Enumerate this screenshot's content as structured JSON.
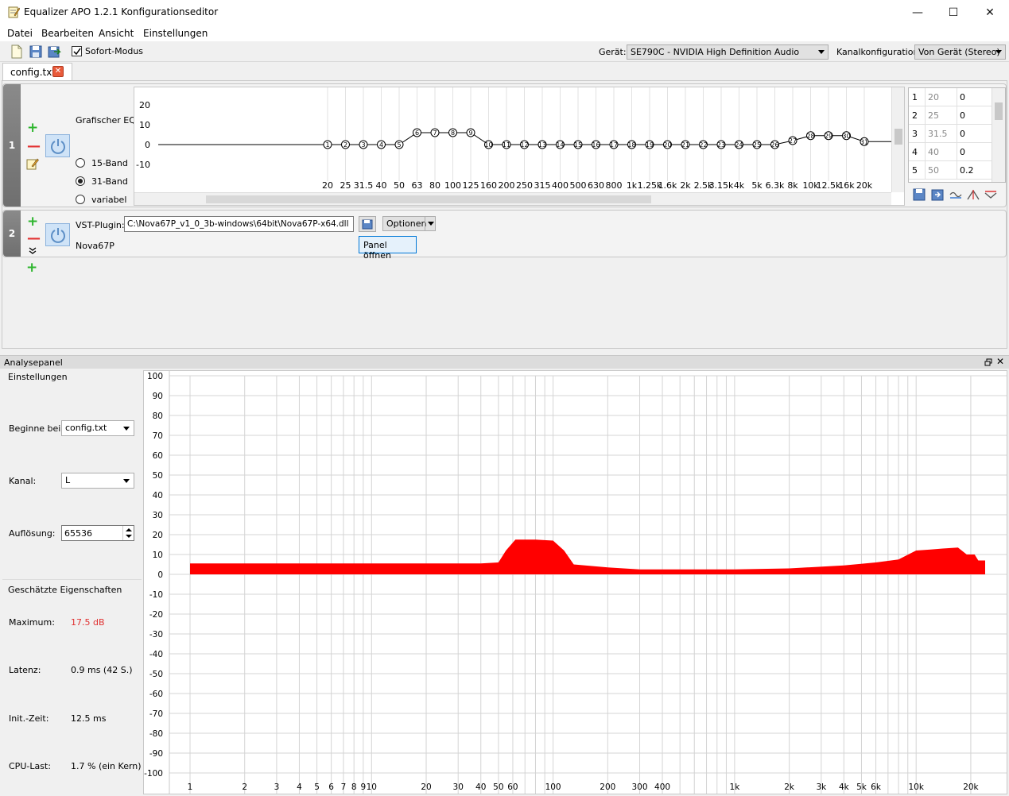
{
  "window": {
    "title": "Equalizer APO 1.2.1 Konfigurationseditor"
  },
  "menu": {
    "items": [
      "Datei",
      "Bearbeiten",
      "Ansicht",
      "Einstellungen"
    ]
  },
  "toolbar": {
    "instant_mode_label": "Sofort-Modus",
    "instant_mode_checked": true,
    "device_label": "Gerät:",
    "device_value": "SE790C - NVIDIA High Definition Audio",
    "channel_config_label": "Kanalkonfiguration:",
    "channel_config_value": "Von Gerät (Stereo)"
  },
  "tabs": [
    {
      "label": "config.txt"
    }
  ],
  "filters": [
    {
      "index": "1",
      "eq_label": "Grafischer EQ:",
      "modes": [
        "15-Band",
        "31-Band",
        "variabel"
      ],
      "selected_mode": "31-Band",
      "y_ticks": [
        "20",
        "10",
        "0",
        "-10"
      ],
      "freq_labels": [
        "20",
        "25",
        "31.5",
        "40",
        "50",
        "63",
        "80",
        "100",
        "125",
        "160",
        "200",
        "250",
        "315",
        "400",
        "500",
        "630",
        "800",
        "1k",
        "1.25k",
        "1.6k",
        "2k",
        "2.5k",
        "3.15k",
        "4k",
        "5k",
        "6.3k",
        "8k",
        "10k",
        "12.5k",
        "16k",
        "20k"
      ],
      "band_gains_db": [
        0,
        0,
        0,
        0,
        0,
        6,
        6,
        6,
        6,
        0,
        0,
        0,
        0,
        0,
        0,
        0,
        0,
        0,
        0,
        0,
        0,
        0,
        0,
        0,
        0,
        0,
        2,
        4.5,
        4.5,
        4.5,
        1.5
      ],
      "band_table": [
        {
          "n": "1",
          "freq": "20",
          "gain": "0"
        },
        {
          "n": "2",
          "freq": "25",
          "gain": "0"
        },
        {
          "n": "3",
          "freq": "31.5",
          "gain": "0"
        },
        {
          "n": "4",
          "freq": "40",
          "gain": "0"
        },
        {
          "n": "5",
          "freq": "50",
          "gain": "0.2"
        }
      ]
    },
    {
      "index": "2",
      "vst_label": "VST-Plugin:",
      "vst_path": "C:\\Nova67P_v1_0_3b-windows\\64bit\\Nova67P-x64.dll",
      "options_label": "Optionen",
      "open_panel_label": "Panel öffnen",
      "plugin_name": "Nova67P"
    }
  ],
  "analysis": {
    "title": "Analysepanel",
    "settings_title": "Einstellungen",
    "start_label": "Beginne bei:",
    "start_value": "config.txt",
    "channel_label": "Kanal:",
    "channel_value": "L",
    "resolution_label": "Auflösung:",
    "resolution_value": "65536",
    "estimated_title": "Geschätzte Eigenschaften",
    "max_label": "Maximum:",
    "max_value": "17.5 dB",
    "latency_label": "Latenz:",
    "latency_value": "0.9 ms (42 S.)",
    "init_label": "Init.-Zeit:",
    "init_value": "12.5 ms",
    "cpu_label": "CPU-Last:",
    "cpu_value": "1.7 % (ein Kern)"
  },
  "chart_data": {
    "type": "area",
    "x_scale": "log",
    "xlim": [
      1,
      24000
    ],
    "ylim": [
      -100,
      100
    ],
    "y_ticks": [
      100,
      90,
      80,
      70,
      60,
      50,
      40,
      30,
      20,
      10,
      0,
      -10,
      -20,
      -30,
      -40,
      -50,
      -60,
      -70,
      -80,
      -90,
      -100
    ],
    "x_tick_labels": [
      {
        "f": 1,
        "t": "1"
      },
      {
        "f": 2,
        "t": "2"
      },
      {
        "f": 3,
        "t": "3"
      },
      {
        "f": 4,
        "t": "4"
      },
      {
        "f": 5,
        "t": "5"
      },
      {
        "f": 6,
        "t": "6"
      },
      {
        "f": 7,
        "t": "7"
      },
      {
        "f": 8,
        "t": "8"
      },
      {
        "f": 9,
        "t": "9"
      },
      {
        "f": 10,
        "t": "10"
      },
      {
        "f": 20,
        "t": "20"
      },
      {
        "f": 30,
        "t": "30"
      },
      {
        "f": 40,
        "t": "40"
      },
      {
        "f": 50,
        "t": "50"
      },
      {
        "f": 60,
        "t": "60"
      },
      {
        "f": 100,
        "t": "100"
      },
      {
        "f": 200,
        "t": "200"
      },
      {
        "f": 300,
        "t": "300"
      },
      {
        "f": 400,
        "t": "400"
      },
      {
        "f": 1000,
        "t": "1k"
      },
      {
        "f": 2000,
        "t": "2k"
      },
      {
        "f": 3000,
        "t": "3k"
      },
      {
        "f": 4000,
        "t": "4k"
      },
      {
        "f": 5000,
        "t": "5k"
      },
      {
        "f": 6000,
        "t": "6k"
      },
      {
        "f": 10000,
        "t": "10k"
      },
      {
        "f": 20000,
        "t": "20k"
      }
    ],
    "fill_color": "#ff0000",
    "series": [
      {
        "x": [
          1,
          10,
          40,
          50,
          55,
          62,
          80,
          100,
          115,
          130,
          200,
          300,
          500,
          1000,
          2000,
          4000,
          6000,
          8000,
          10000,
          12000,
          14000,
          17000,
          19000,
          21000,
          22000,
          24000
        ],
        "y": [
          5.5,
          5.5,
          5.5,
          6,
          12,
          17.5,
          17.5,
          17,
          12,
          5,
          3.5,
          2.5,
          2.5,
          2.5,
          3,
          4.5,
          6,
          7.5,
          12,
          12.5,
          13,
          13.5,
          10,
          10,
          7,
          7
        ]
      }
    ]
  }
}
